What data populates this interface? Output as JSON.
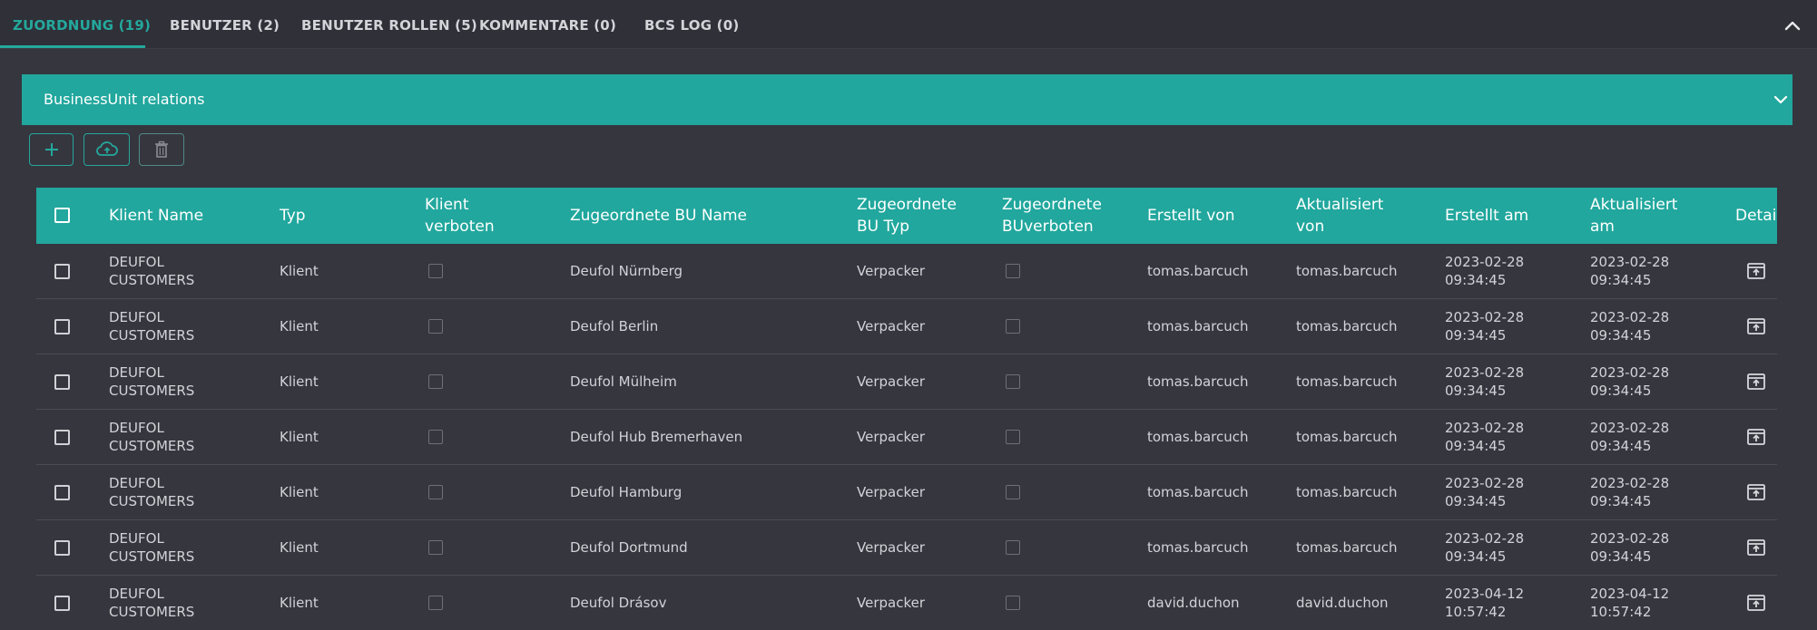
{
  "tabs": [
    {
      "label": "ZUORDNUNG (19)",
      "active": true
    },
    {
      "label": "BENUTZER (2)",
      "active": false
    },
    {
      "label": "BENUTZER ROLLEN (5)",
      "active": false
    },
    {
      "label": "KOMMENTARE (0)",
      "active": false
    },
    {
      "label": "BCS LOG (0)",
      "active": false
    }
  ],
  "panel": {
    "title": "BusinessUnit relations"
  },
  "toolbar": {
    "add_icon": "plus-icon",
    "upload_icon": "cloud-upload-icon",
    "delete_icon": "trash-icon"
  },
  "colors": {
    "accent": "#21a79d",
    "background": "#36363f",
    "tabbar": "#2f3038"
  },
  "table": {
    "columns": [
      "Klient Name",
      "Typ",
      "Klient\nverboten",
      "Zugeordnete BU Name",
      "Zugeordnete\nBU Typ",
      "Zugeordnete\nBUverboten",
      "Erstellt von",
      "Aktualisiert\nvon",
      "Erstellt am",
      "Aktualisiert\nam",
      "Detail"
    ],
    "rows": [
      {
        "klient": "Deufol\nCustomers",
        "typ": "Klient",
        "bu_name": "Deufol Nürnberg",
        "bu_typ": "Verpacker",
        "erstellt_von": "tomas.barcuch",
        "aktualisiert_von": "tomas.barcuch",
        "erstellt_am": "2023-02-28\n09:34:45",
        "aktualisiert_am": "2023-02-28\n09:34:45"
      },
      {
        "klient": "Deufol\nCustomers",
        "typ": "Klient",
        "bu_name": "Deufol Berlin",
        "bu_typ": "Verpacker",
        "erstellt_von": "tomas.barcuch",
        "aktualisiert_von": "tomas.barcuch",
        "erstellt_am": "2023-02-28\n09:34:45",
        "aktualisiert_am": "2023-02-28\n09:34:45"
      },
      {
        "klient": "Deufol\nCustomers",
        "typ": "Klient",
        "bu_name": "Deufol Mülheim",
        "bu_typ": "Verpacker",
        "erstellt_von": "tomas.barcuch",
        "aktualisiert_von": "tomas.barcuch",
        "erstellt_am": "2023-02-28\n09:34:45",
        "aktualisiert_am": "2023-02-28\n09:34:45"
      },
      {
        "klient": "Deufol\nCustomers",
        "typ": "Klient",
        "bu_name": "Deufol Hub Bremerhaven",
        "bu_typ": "Verpacker",
        "erstellt_von": "tomas.barcuch",
        "aktualisiert_von": "tomas.barcuch",
        "erstellt_am": "2023-02-28\n09:34:45",
        "aktualisiert_am": "2023-02-28\n09:34:45"
      },
      {
        "klient": "Deufol\nCustomers",
        "typ": "Klient",
        "bu_name": "Deufol Hamburg",
        "bu_typ": "Verpacker",
        "erstellt_von": "tomas.barcuch",
        "aktualisiert_von": "tomas.barcuch",
        "erstellt_am": "2023-02-28\n09:34:45",
        "aktualisiert_am": "2023-02-28\n09:34:45"
      },
      {
        "klient": "Deufol\nCustomers",
        "typ": "Klient",
        "bu_name": "Deufol Dortmund",
        "bu_typ": "Verpacker",
        "erstellt_von": "tomas.barcuch",
        "aktualisiert_von": "tomas.barcuch",
        "erstellt_am": "2023-02-28\n09:34:45",
        "aktualisiert_am": "2023-02-28\n09:34:45"
      },
      {
        "klient": "Deufol\nCustomers",
        "typ": "Klient",
        "bu_name": "Deufol Drásov",
        "bu_typ": "Verpacker",
        "erstellt_von": "david.duchon",
        "aktualisiert_von": "david.duchon",
        "erstellt_am": "2023-04-12\n10:57:42",
        "aktualisiert_am": "2023-04-12\n10:57:42"
      }
    ]
  }
}
